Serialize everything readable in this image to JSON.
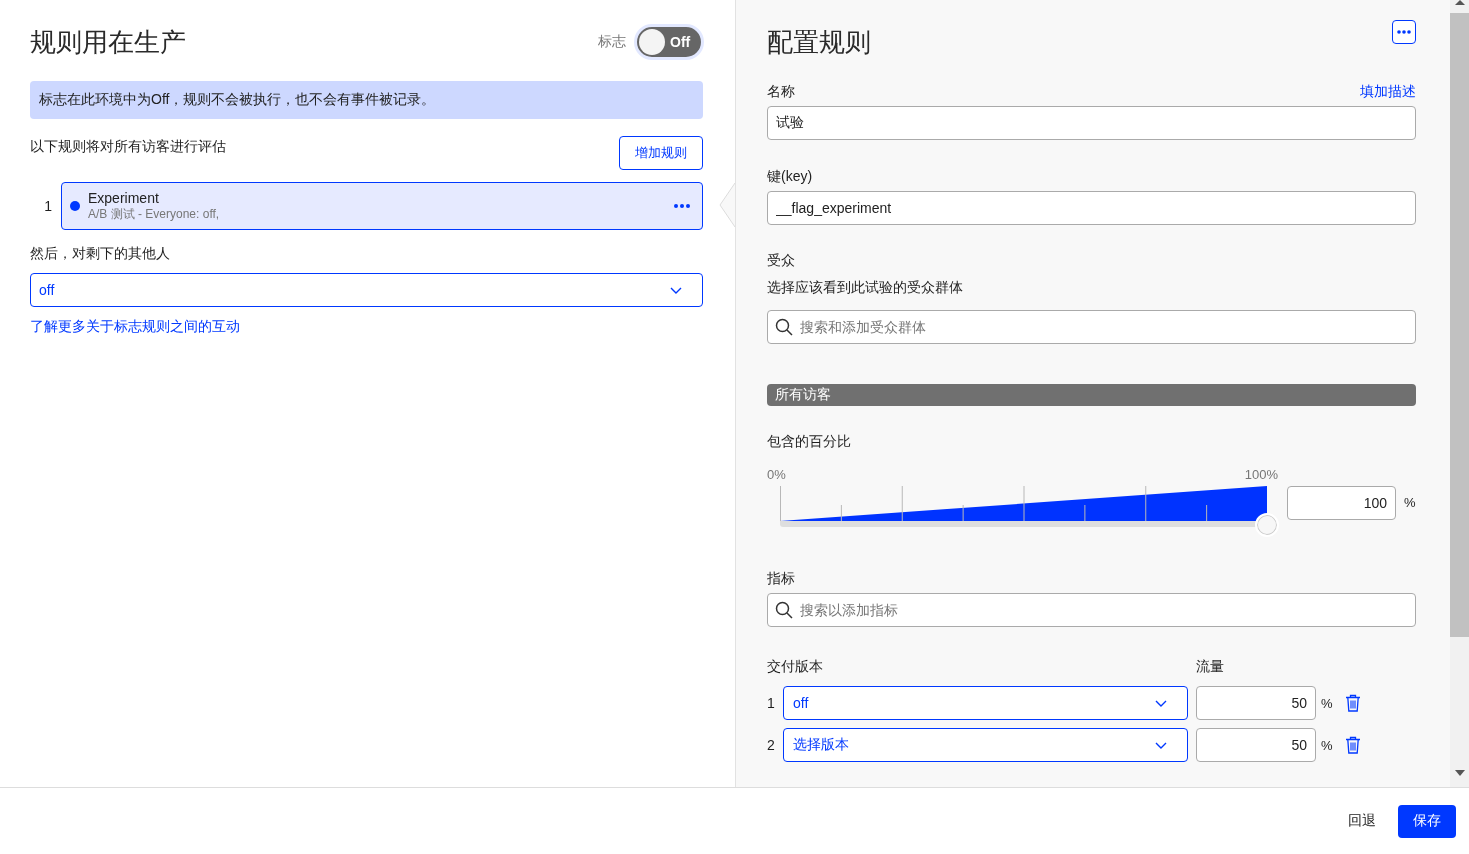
{
  "left": {
    "title": "规则用在生产",
    "flag_toggle": {
      "label": "标志",
      "on": false,
      "text": "Off"
    },
    "notice": "标志在此环境中为Off，规则不会被执行，也不会有事件被记录。",
    "rules_intro": "以下规则将对所有访客进行评估",
    "add_rule_button": "增加规则",
    "rules": [
      {
        "index": "1",
        "name": "Experiment",
        "summary": "A/B 测试 - Everyone: off,",
        "color": "#0038ff",
        "selected": true
      }
    ],
    "fallthrough_label": "然后，对剩下的其他人",
    "fallthrough_select": {
      "value": "off"
    },
    "learn_more_link": "了解更多关于标志规则之间的互动"
  },
  "right": {
    "title": "配置规则",
    "name_field": {
      "label": "名称",
      "link": "填加描述",
      "value": "试验"
    },
    "key_field": {
      "label": "键(key)",
      "value": "__flag_experiment"
    },
    "audience": {
      "label": "受众",
      "hint": "选择应该看到此试验的受众群体",
      "placeholder": "搜索和添加受众群体"
    },
    "audience_bar": "所有访客",
    "inclusion": {
      "label": "包含的百分比",
      "min_label": "0%",
      "max_label": "100%",
      "level": 1,
      "value": "100",
      "unit": "%"
    },
    "metrics": {
      "label": "指标",
      "placeholder": "搜索以添加指标"
    },
    "variations": {
      "label": "交付版本",
      "traffic_label": "流量",
      "rows": [
        {
          "index": "1",
          "value": "off",
          "traffic": "50",
          "unit": "%"
        },
        {
          "index": "2",
          "value": "选择版本",
          "traffic": "50",
          "unit": "%"
        }
      ]
    }
  },
  "footer": {
    "buttons": [
      {
        "label": "回退",
        "kind": "text"
      },
      {
        "label": "保存",
        "kind": "primary"
      }
    ]
  }
}
